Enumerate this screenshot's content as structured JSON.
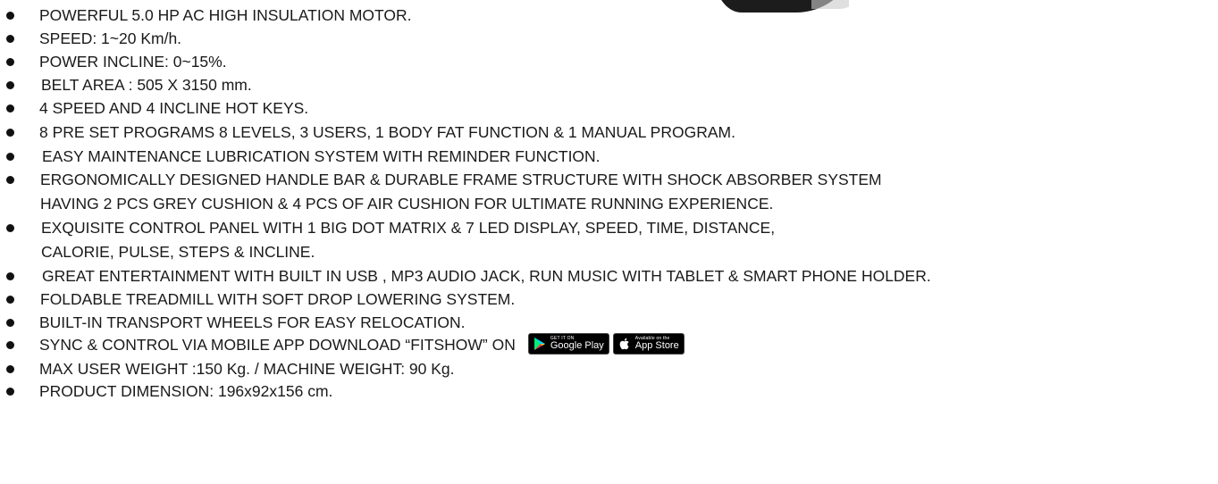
{
  "features": [
    {
      "lines": [
        "POWERFUL 5.0 HP AC HIGH INSULATION MOTOR."
      ]
    },
    {
      "lines": [
        "SPEED: 1~20 Km/h."
      ]
    },
    {
      "lines": [
        "POWER INCLINE: 0~15%."
      ]
    },
    {
      "lines": [
        "BELT AREA : 505 X 3150 mm."
      ]
    },
    {
      "lines": [
        "4 SPEED AND 4 INCLINE HOT KEYS."
      ]
    },
    {
      "lines": [
        "8 PRE SET PROGRAMS 8 LEVELS, 3 USERS, 1 BODY FAT FUNCTION & 1 MANUAL PROGRAM."
      ]
    },
    {
      "lines": [
        "EASY MAINTENANCE LUBRICATION SYSTEM WITH REMINDER FUNCTION."
      ]
    },
    {
      "lines": [
        "ERGONOMICALLY DESIGNED HANDLE BAR & DURABLE FRAME STRUCTURE WITH SHOCK ABSORBER SYSTEM",
        "HAVING 2 PCS GREY CUSHION & 4 PCS OF AIR CUSHION FOR ULTIMATE RUNNING EXPERIENCE."
      ]
    },
    {
      "lines": [
        "EXQUISITE CONTROL PANEL WITH 1 BIG DOT MATRIX & 7 LED DISPLAY, SPEED, TIME, DISTANCE,",
        "CALORIE, PULSE, STEPS & INCLINE."
      ]
    },
    {
      "lines": [
        "GREAT ENTERTAINMENT WITH BUILT IN USB , MP3 AUDIO JACK, RUN MUSIC WITH TABLET & SMART PHONE HOLDER."
      ]
    },
    {
      "lines": [
        "FOLDABLE TREADMILL WITH SOFT DROP LOWERING SYSTEM."
      ]
    },
    {
      "lines": [
        "BUILT-IN TRANSPORT WHEELS FOR EASY RELOCATION."
      ]
    },
    {
      "lines": [
        "SYNC & CONTROL VIA MOBILE APP DOWNLOAD “FITSHOW” ON"
      ],
      "badges": true
    },
    {
      "lines": [
        "MAX USER WEIGHT :150 Kg. / MACHINE WEIGHT: 90 Kg."
      ]
    },
    {
      "lines": [
        "PRODUCT DIMENSION: 196x92x156 cm."
      ]
    }
  ],
  "badges": {
    "google_play": {
      "small": "GET IT ON",
      "big": "Google Play",
      "icon": "play-triangle-icon"
    },
    "app_store": {
      "small": "Available on the",
      "big": "App Store",
      "icon": "apple-icon"
    }
  },
  "colors": {
    "text": "#1a1a1a",
    "bullet": "#111111",
    "badge_bg": "#000000"
  }
}
